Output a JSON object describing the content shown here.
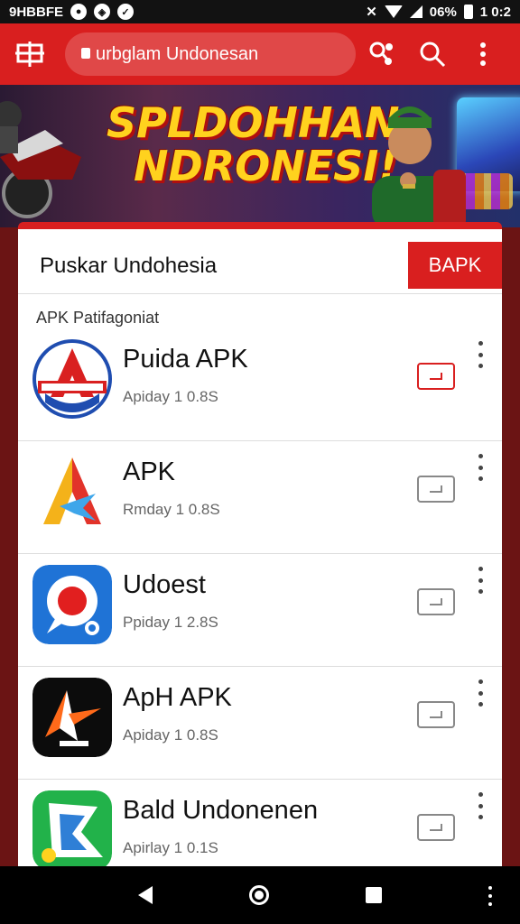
{
  "status_bar": {
    "left_text": "9HBBFE",
    "battery_text": "06%",
    "time": "1 0:2"
  },
  "browser": {
    "url_text": "urbglam Undonesan"
  },
  "banner": {
    "line1": "SPLDOHHAN",
    "line2": "NDRONESI!"
  },
  "sheet": {
    "title": "Puskar Undohesia",
    "action_label": "BAPK",
    "section_label": "APK Patifagoniat"
  },
  "apps": [
    {
      "name": "Puida APK",
      "meta": "Apiday 1 0.8S",
      "download_active": true,
      "icon": "red-blue-a-logo-icon"
    },
    {
      "name": "APK",
      "meta": "Rmday 1 0.8S",
      "download_active": false,
      "icon": "yellow-red-jet-a-icon"
    },
    {
      "name": "Udoest",
      "meta": "Ppiday 1 2.8S",
      "download_active": false,
      "icon": "blue-red-sun-icon"
    },
    {
      "name": "ApH APK",
      "meta": "Apiday 1 0.8S",
      "download_active": false,
      "icon": "black-orange-a-icon"
    },
    {
      "name": "Bald Undonenen",
      "meta": "Apirlay 1 0.1S",
      "download_active": false,
      "icon": "green-white-a-icon"
    }
  ],
  "colors": {
    "brand_red": "#d91f1f",
    "banner_yellow": "#ffd21e"
  }
}
